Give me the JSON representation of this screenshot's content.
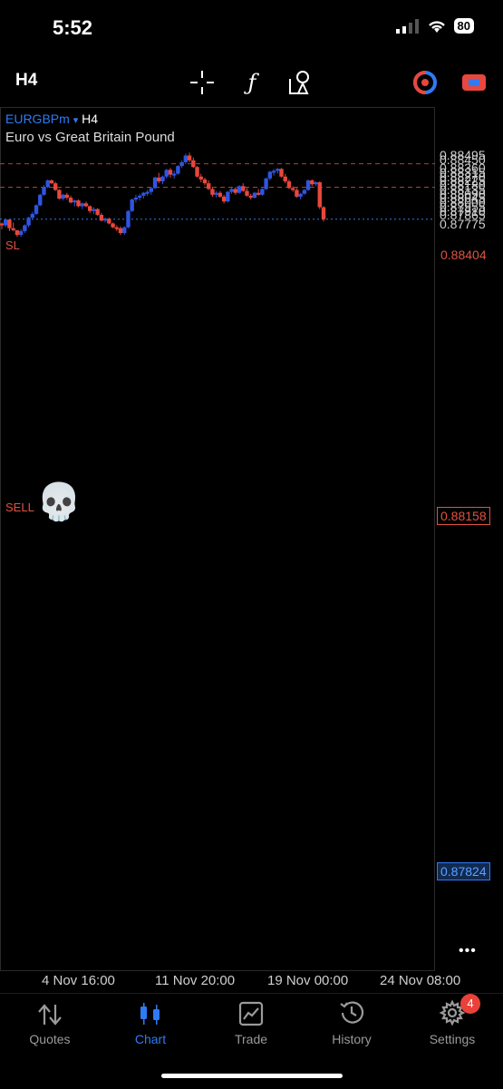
{
  "status_bar": {
    "time": "5:52",
    "battery": "80"
  },
  "toolbar": {
    "timeframe": "H4",
    "tools": [
      "crosshair-icon",
      "function-icon",
      "objects-icon",
      "indicator-icon",
      "trade-toggle-icon"
    ]
  },
  "chart": {
    "symbol": "EURGBPm",
    "arrow": "▾",
    "timeframe": "H4",
    "description": "Euro vs Great Britain Pound",
    "sl_label": "SL",
    "sl_price": "0.88404",
    "sell_label": "SELL",
    "sell_price": "0.88158",
    "current_price": "0.87824",
    "emoji": "💀",
    "more": "•••",
    "price_ticks": [
      "0.88495",
      "0.88450",
      "0.88360",
      "0.88315",
      "0.88270",
      "0.88225",
      "0.88180",
      "0.88135",
      "0.88090",
      "0.88045",
      "0.88000",
      "0.87955",
      "0.87910",
      "0.87865",
      "0.87775"
    ],
    "date_ticks": [
      "4 Nov 16:00",
      "11 Nov 20:00",
      "19 Nov 00:00",
      "24 Nov 08:00"
    ],
    "colors": {
      "bull": "#2f55e0",
      "bear": "#e8473d",
      "sl": "#e0523f",
      "current": "#2f7bf5"
    }
  },
  "chart_data": {
    "type": "candlestick",
    "title": "",
    "ylim": [
      0.8774,
      0.8851
    ],
    "x_ticks": [
      "4 Nov 16:00",
      "11 Nov 20:00",
      "19 Nov 00:00",
      "24 Nov 08:00"
    ],
    "y_ticks": [
      0.88495,
      0.8845,
      0.8836,
      0.88315,
      0.8827,
      0.88225,
      0.8818,
      0.88135,
      0.8809,
      0.88045,
      0.88,
      0.87955,
      0.8791,
      0.87865,
      0.87775
    ],
    "horizontal_lines": [
      {
        "label": "SL",
        "value": 0.88404
      },
      {
        "label": "SELL",
        "value": 0.88158
      },
      {
        "label": "",
        "value": 0.87824
      }
    ],
    "candles": [
      [
        0.8778,
        0.8779,
        0.8772,
        0.8776
      ],
      [
        0.8776,
        0.87825,
        0.8774,
        0.8782
      ],
      [
        0.8782,
        0.87825,
        0.877,
        0.8773
      ],
      [
        0.8773,
        0.8779,
        0.877,
        0.8771
      ],
      [
        0.8771,
        0.877,
        0.8764,
        0.8766
      ],
      [
        0.8766,
        0.8772,
        0.8764,
        0.877
      ],
      [
        0.877,
        0.8777,
        0.8768,
        0.8776
      ],
      [
        0.8776,
        0.8785,
        0.8774,
        0.8784
      ],
      [
        0.8784,
        0.879,
        0.8782,
        0.8788
      ],
      [
        0.8788,
        0.8798,
        0.8787,
        0.8797
      ],
      [
        0.8797,
        0.8809,
        0.8796,
        0.8808
      ],
      [
        0.8808,
        0.8818,
        0.8807,
        0.8816
      ],
      [
        0.8816,
        0.8824,
        0.8815,
        0.8823
      ],
      [
        0.8823,
        0.8824,
        0.8819,
        0.882
      ],
      [
        0.882,
        0.88215,
        0.8812,
        0.8813
      ],
      [
        0.8813,
        0.8814,
        0.8803,
        0.8804
      ],
      [
        0.8804,
        0.8809,
        0.8802,
        0.8808
      ],
      [
        0.8808,
        0.881,
        0.8803,
        0.8805
      ],
      [
        0.8805,
        0.8807,
        0.8799,
        0.88
      ],
      [
        0.88,
        0.8803,
        0.8796,
        0.8802
      ],
      [
        0.8802,
        0.8803,
        0.8795,
        0.8796
      ],
      [
        0.8796,
        0.88,
        0.8793,
        0.8799
      ],
      [
        0.8799,
        0.8801,
        0.8795,
        0.8796
      ],
      [
        0.8796,
        0.8797,
        0.8789,
        0.8791
      ],
      [
        0.8791,
        0.8795,
        0.8788,
        0.8793
      ],
      [
        0.8793,
        0.8794,
        0.8786,
        0.8787
      ],
      [
        0.8787,
        0.8789,
        0.878,
        0.8781
      ],
      [
        0.8781,
        0.8784,
        0.8779,
        0.8783
      ],
      [
        0.8783,
        0.8784,
        0.8777,
        0.8778
      ],
      [
        0.8778,
        0.8779,
        0.8773,
        0.8774
      ],
      [
        0.8774,
        0.8776,
        0.877,
        0.8773
      ],
      [
        0.8773,
        0.8775,
        0.8766,
        0.8768
      ],
      [
        0.8768,
        0.8775,
        0.8766,
        0.8774
      ],
      [
        0.8774,
        0.8792,
        0.8773,
        0.8791
      ],
      [
        0.8791,
        0.8804,
        0.879,
        0.8803
      ],
      [
        0.8803,
        0.8808,
        0.88,
        0.8805
      ],
      [
        0.8805,
        0.8809,
        0.8802,
        0.8807
      ],
      [
        0.8807,
        0.8811,
        0.8804,
        0.881
      ],
      [
        0.881,
        0.8813,
        0.8807,
        0.8811
      ],
      [
        0.8811,
        0.8816,
        0.8808,
        0.8815
      ],
      [
        0.8815,
        0.8827,
        0.8814,
        0.8826
      ],
      [
        0.8826,
        0.8831,
        0.882,
        0.8822
      ],
      [
        0.8822,
        0.8828,
        0.8819,
        0.8827
      ],
      [
        0.8827,
        0.8835,
        0.8825,
        0.8834
      ],
      [
        0.8834,
        0.8836,
        0.8826,
        0.8829
      ],
      [
        0.8829,
        0.8833,
        0.8825,
        0.883
      ],
      [
        0.883,
        0.8839,
        0.8829,
        0.8838
      ],
      [
        0.8838,
        0.8844,
        0.8836,
        0.8842
      ],
      [
        0.8842,
        0.8851,
        0.884,
        0.8849
      ],
      [
        0.8849,
        0.8852,
        0.8842,
        0.8844
      ],
      [
        0.8844,
        0.8847,
        0.8836,
        0.8837
      ],
      [
        0.8837,
        0.8838,
        0.8826,
        0.8827
      ],
      [
        0.8827,
        0.883,
        0.8821,
        0.8824
      ],
      [
        0.8824,
        0.8826,
        0.8818,
        0.882
      ],
      [
        0.882,
        0.8823,
        0.8813,
        0.8814
      ],
      [
        0.8814,
        0.8816,
        0.8806,
        0.8808
      ],
      [
        0.8808,
        0.8812,
        0.8805,
        0.881
      ],
      [
        0.881,
        0.8812,
        0.8805,
        0.8806
      ],
      [
        0.8806,
        0.8808,
        0.8799,
        0.8801
      ],
      [
        0.8801,
        0.8812,
        0.88,
        0.8811
      ],
      [
        0.8811,
        0.8816,
        0.8809,
        0.8814
      ],
      [
        0.8814,
        0.8816,
        0.8808,
        0.881
      ],
      [
        0.881,
        0.8818,
        0.8809,
        0.8817
      ],
      [
        0.8817,
        0.882,
        0.8811,
        0.8812
      ],
      [
        0.8812,
        0.8815,
        0.8806,
        0.8807
      ],
      [
        0.8807,
        0.8809,
        0.8803,
        0.8805
      ],
      [
        0.8805,
        0.8811,
        0.8804,
        0.881
      ],
      [
        0.881,
        0.8814,
        0.8807,
        0.8808
      ],
      [
        0.8808,
        0.8815,
        0.8807,
        0.8814
      ],
      [
        0.8814,
        0.8826,
        0.8813,
        0.8825
      ],
      [
        0.8825,
        0.8833,
        0.8823,
        0.8832
      ],
      [
        0.8832,
        0.8835,
        0.8828,
        0.8833
      ],
      [
        0.8833,
        0.8836,
        0.883,
        0.8835
      ],
      [
        0.8835,
        0.8836,
        0.8826,
        0.8827
      ],
      [
        0.8827,
        0.883,
        0.882,
        0.8822
      ],
      [
        0.8822,
        0.8824,
        0.8814,
        0.8815
      ],
      [
        0.8815,
        0.8817,
        0.8811,
        0.8813
      ],
      [
        0.8813,
        0.8815,
        0.8805,
        0.8806
      ],
      [
        0.8806,
        0.881,
        0.8803,
        0.8809
      ],
      [
        0.8809,
        0.8814,
        0.8808,
        0.8813
      ],
      [
        0.8813,
        0.8824,
        0.8812,
        0.8823
      ],
      [
        0.8823,
        0.8824,
        0.8817,
        0.8819
      ],
      [
        0.8819,
        0.8822,
        0.8817,
        0.8821
      ],
      [
        0.8821,
        0.8822,
        0.8793,
        0.8795
      ],
      [
        0.8795,
        0.8796,
        0.878,
        0.87824
      ]
    ]
  },
  "tabs": [
    {
      "label": "Quotes",
      "icon": "quotes-icon",
      "active": false
    },
    {
      "label": "Chart",
      "icon": "chart-icon",
      "active": true
    },
    {
      "label": "Trade",
      "icon": "trade-icon",
      "active": false
    },
    {
      "label": "History",
      "icon": "history-icon",
      "active": false
    },
    {
      "label": "Settings",
      "icon": "settings-icon",
      "active": false,
      "badge": "4"
    }
  ]
}
